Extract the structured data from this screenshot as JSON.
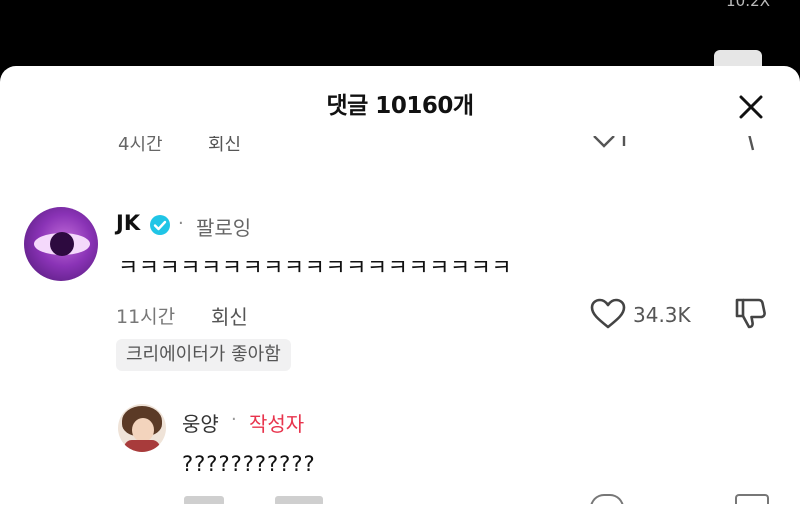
{
  "status_bar": {
    "corner_text": "10:2X"
  },
  "sheet": {
    "title": "댓글 10160개"
  },
  "previous_comment": {
    "time": "4시간",
    "reply": "회신"
  },
  "comment": {
    "username": "JK",
    "verified": true,
    "separator": "·",
    "follow_status": "팔로잉",
    "text": "ㅋㅋㅋㅋㅋㅋㅋㅋㅋㅋㅋㅋㅋㅋㅋㅋㅋㅋㅋ",
    "time": "11시간",
    "reply_label": "회신",
    "like_count": "34.3K",
    "creator_badge": "크리에이터가 좋아함"
  },
  "reply": {
    "username": "웅양",
    "separator": "·",
    "author_tag": "작성자",
    "text": "???????????"
  },
  "colors": {
    "author_tag": "#e8344d",
    "verified": "#20c5e6"
  },
  "icons": [
    "close-icon",
    "verified-icon",
    "heart-icon",
    "thumbs-down-icon"
  ]
}
